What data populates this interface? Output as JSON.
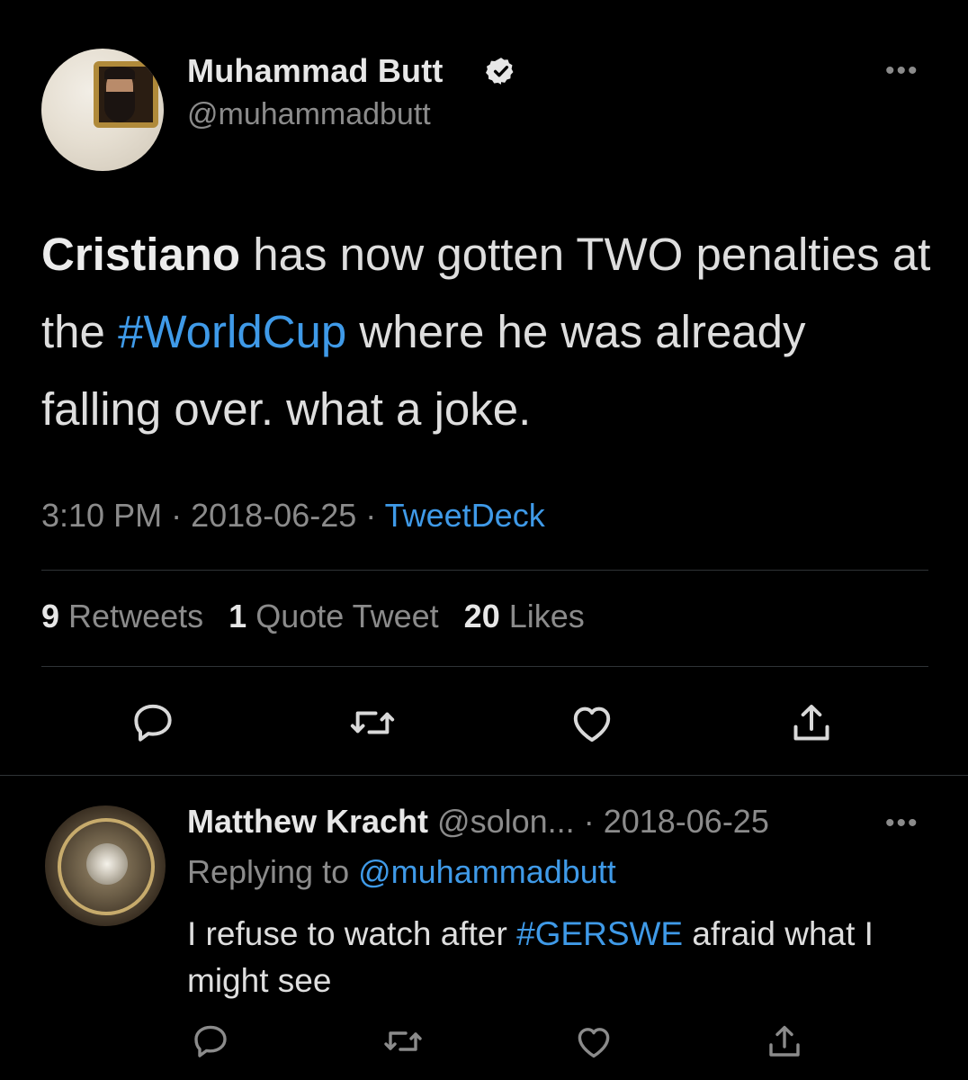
{
  "tweet": {
    "author": {
      "display_name": "Muhammad Butt",
      "handle": "@muhammadbutt",
      "verified": true
    },
    "text": {
      "bold_lead": "Cristiano",
      "part1": " has now gotten TWO penalties at the ",
      "hashtag": "#WorldCup",
      "part2": " where he was already falling over. what a joke."
    },
    "time": "3:10 PM",
    "separator": "·",
    "date": "2018-06-25",
    "source": "TweetDeck",
    "stats": {
      "retweets_count": "9",
      "retweets_label": "Retweets",
      "quotes_count": "1",
      "quotes_label": "Quote Tweet",
      "likes_count": "20",
      "likes_label": "Likes"
    },
    "more_icon": "•••"
  },
  "reply": {
    "author_name": "Matthew Kracht",
    "handle": "@solon...",
    "separator": "·",
    "date": "2018-06-25",
    "replying_label": "Replying to",
    "replying_to": "@muhammadbutt",
    "text_part1": "I refuse to watch after ",
    "hashtag": "#GERSWE",
    "text_part2": " afraid what I might see",
    "more_icon": "•••"
  },
  "icons": [
    "comment-icon",
    "retweet-icon",
    "heart-icon",
    "share-icon",
    "verified-badge-icon",
    "more-icon"
  ],
  "colors": {
    "background": "#000000",
    "link": "#3f9ae8",
    "secondary_text": "#8b8b8b",
    "primary_text": "#dedede",
    "divider": "#2f3336"
  }
}
